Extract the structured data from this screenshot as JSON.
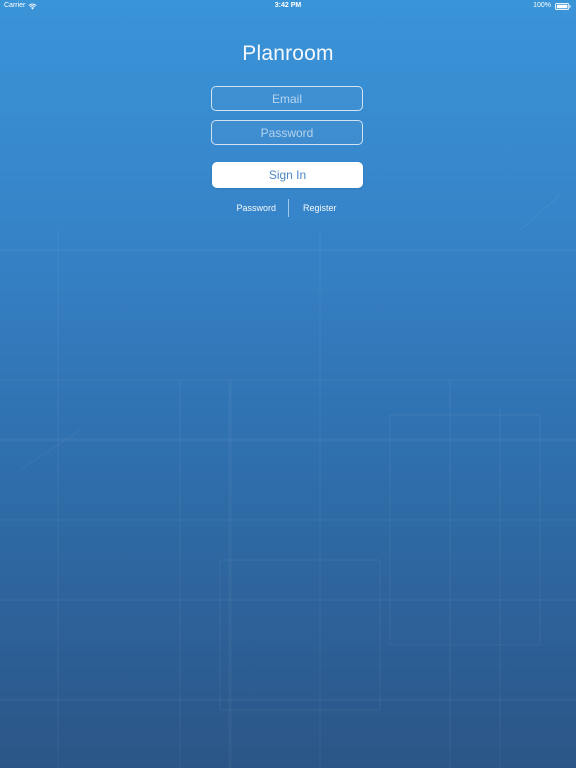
{
  "status_bar": {
    "carrier": "Carrier",
    "time": "3:42 PM",
    "battery": "100%",
    "wifi_icon": "wifi-icon",
    "battery_icon": "battery-icon"
  },
  "app": {
    "title": "Planroom"
  },
  "login": {
    "email_placeholder": "Email",
    "email_value": "",
    "password_placeholder": "Password",
    "password_value": "",
    "sign_in_label": "Sign In",
    "sign_in_text_color": "#4a86c2"
  },
  "links": {
    "password_label": "Password",
    "register_label": "Register"
  },
  "colors": {
    "background_top": "#3a94d8",
    "background_bottom": "#2b5586",
    "button_background": "#ffffff"
  }
}
